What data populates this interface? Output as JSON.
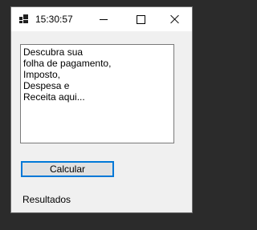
{
  "window": {
    "title": "15:30:57",
    "controls": {
      "minimize_icon": "minimize-icon",
      "maximize_icon": "maximize-icon",
      "close_icon": "close-icon"
    }
  },
  "form": {
    "textbox_lines": [
      "Descubra sua",
      "folha de pagamento,",
      "Imposto,",
      "Despesa e",
      "Receita aqui..."
    ],
    "calcular_label": "Calcular",
    "resultados_label": "Resultados"
  },
  "colors": {
    "focus_border": "#0078d7",
    "window_background": "#f0f0f0",
    "titlebar_background": "#ffffff"
  }
}
